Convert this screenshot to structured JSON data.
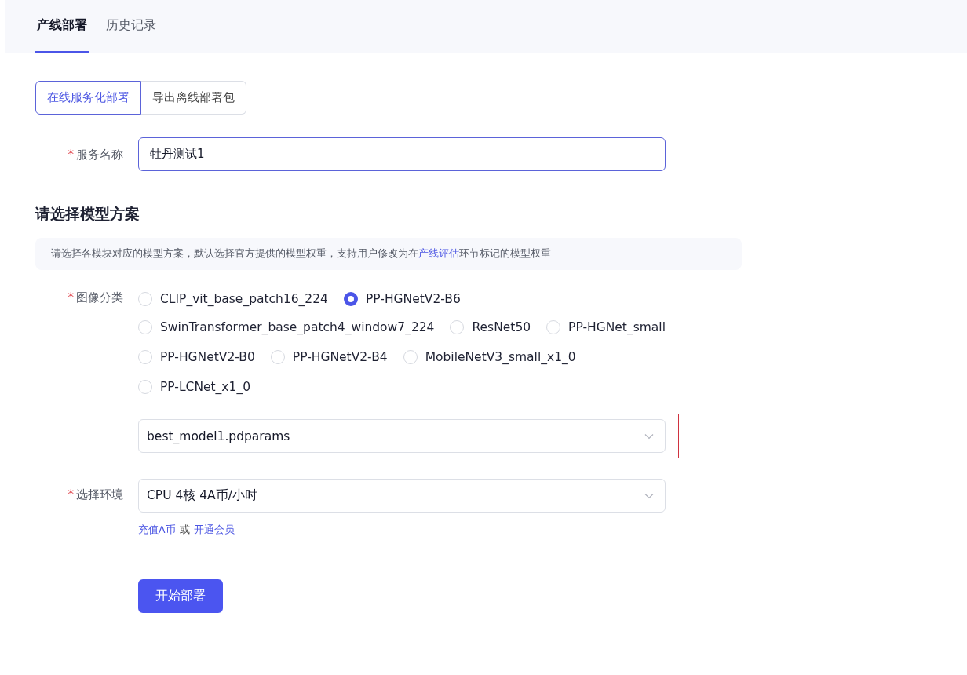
{
  "tabs": [
    {
      "label": "产线部署",
      "selected": true
    },
    {
      "label": "历史记录",
      "selected": false
    }
  ],
  "mode_switch": [
    {
      "label": "在线服务化部署",
      "selected": true
    },
    {
      "label": "导出离线部署包",
      "selected": false
    }
  ],
  "service_name": {
    "label": "服务名称",
    "required_mark": "*",
    "value": "牡丹测试1"
  },
  "section_title": "请选择模型方案",
  "notice_parts": [
    {
      "text": "请选择各模块对应的模型方案，默认选择官方提供的模型权重，支持用户修改为在",
      "link": false
    },
    {
      "text": "产线评估",
      "link": true
    },
    {
      "text": "环节标记的模型权重",
      "link": false
    }
  ],
  "model_group": {
    "label": "图像分类",
    "required_mark": "*",
    "option_rows": [
      [
        {
          "label": "CLIP_vit_base_patch16_224",
          "selected": false
        },
        {
          "label": "PP-HGNetV2-B6",
          "selected": true
        }
      ],
      [
        {
          "label": "SwinTransformer_base_patch4_window7_224",
          "selected": false
        },
        {
          "label": "ResNet50",
          "selected": false
        },
        {
          "label": "PP-HGNet_small",
          "selected": false
        }
      ],
      [
        {
          "label": "PP-HGNetV2-B0",
          "selected": false
        },
        {
          "label": "PP-HGNetV2-B4",
          "selected": false
        },
        {
          "label": "MobileNetV3_small_x1_0",
          "selected": false
        }
      ],
      [
        {
          "label": "PP-LCNet_x1_0",
          "selected": false
        }
      ]
    ],
    "weights": {
      "value": "best_model1.pdparams",
      "highlighted": true
    }
  },
  "environment": {
    "label": "选择环境",
    "required_mark": "*",
    "value": "CPU 4核 4A币/小时"
  },
  "recharge": [
    {
      "text": "充值A币",
      "link": true
    },
    {
      "text": "或",
      "link": false
    },
    {
      "text": "开通会员",
      "link": true
    }
  ],
  "submit_button": "开始部署"
}
